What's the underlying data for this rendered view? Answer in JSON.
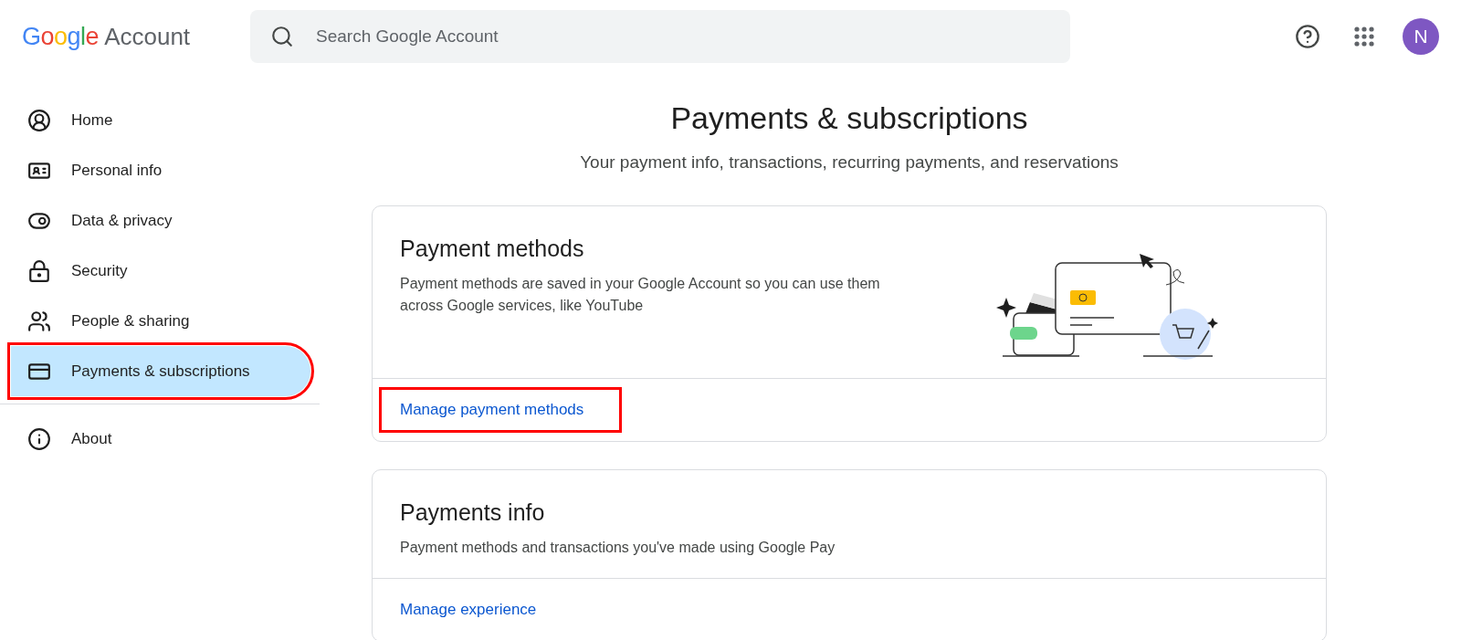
{
  "header": {
    "logo": {
      "brand": "Google",
      "product": "Account"
    },
    "search": {
      "placeholder": "Search Google Account"
    },
    "avatar": "N"
  },
  "sidebar": {
    "items": [
      {
        "label": "Home",
        "selected": false,
        "highlighted": false
      },
      {
        "label": "Personal info",
        "selected": false,
        "highlighted": false
      },
      {
        "label": "Data & privacy",
        "selected": false,
        "highlighted": false
      },
      {
        "label": "Security",
        "selected": false,
        "highlighted": false
      },
      {
        "label": "People & sharing",
        "selected": false,
        "highlighted": false
      },
      {
        "label": "Payments & subscriptions",
        "selected": true,
        "highlighted": true
      }
    ],
    "footer_items": [
      {
        "label": "About",
        "selected": false,
        "highlighted": false
      }
    ]
  },
  "page": {
    "title": "Payments & subscriptions",
    "subtitle": "Your payment info, transactions, recurring payments, and reservations"
  },
  "cards": [
    {
      "kind": "illustrated",
      "title": "Payment methods",
      "description": "Payment methods are saved in your Google Account so you can use them across Google services, like YouTube",
      "link": {
        "label": "Manage payment methods",
        "highlighted": true
      }
    },
    {
      "kind": "plain",
      "title": "Payments info",
      "description": "Payment methods and transactions you've made using Google Pay",
      "link": {
        "label": "Manage experience",
        "highlighted": false
      }
    }
  ]
}
